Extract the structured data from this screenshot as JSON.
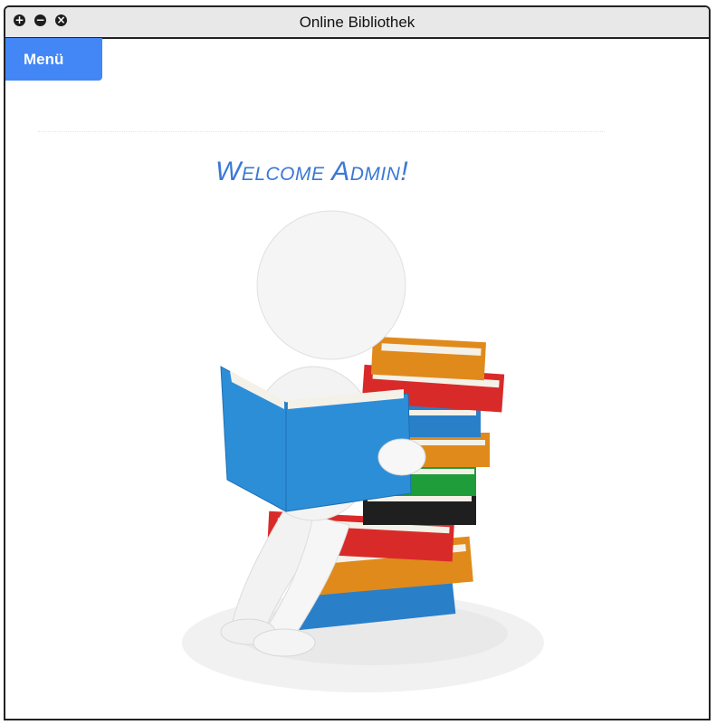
{
  "window": {
    "title": "Online Bibliothek",
    "controls": {
      "add": "+",
      "minimize": "−",
      "close": "×"
    }
  },
  "menu": {
    "label": "Menü"
  },
  "main": {
    "welcome": "Welcome Admin!"
  },
  "colors": {
    "accent": "#4287f5",
    "welcome_text": "#3a78d6",
    "titlebar": "#e8e8e8"
  },
  "illustration": {
    "icon": "reading-person-with-books"
  }
}
